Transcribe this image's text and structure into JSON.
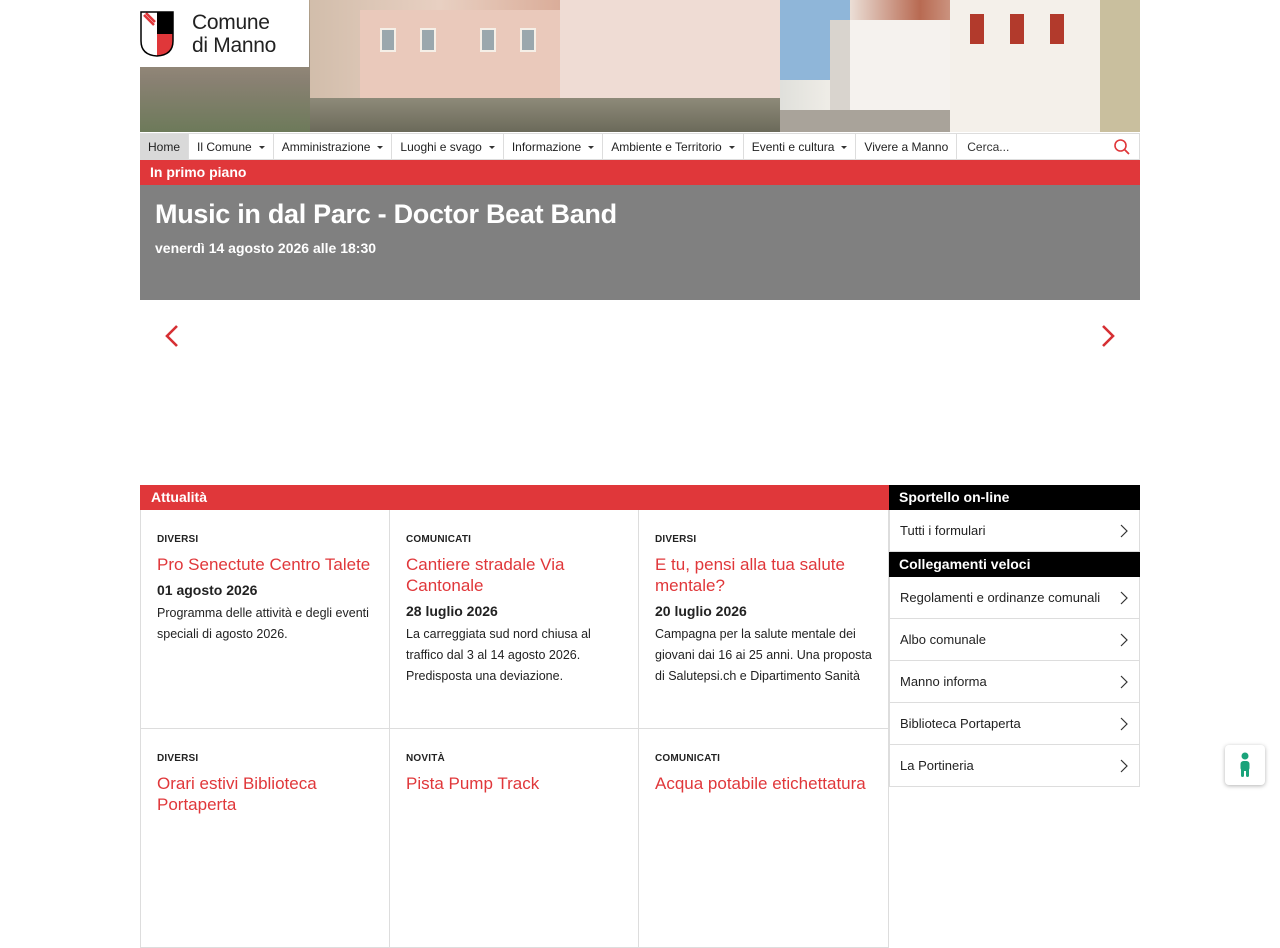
{
  "logo": {
    "line1": "Comune",
    "line2": "di Manno"
  },
  "nav": {
    "items": [
      {
        "label": "Home",
        "dropdown": false
      },
      {
        "label": "Il Comune",
        "dropdown": true
      },
      {
        "label": "Amministrazione",
        "dropdown": true
      },
      {
        "label": "Luoghi e svago",
        "dropdown": true
      },
      {
        "label": "Informazione",
        "dropdown": true
      },
      {
        "label": "Ambiente e Territorio",
        "dropdown": true
      },
      {
        "label": "Eventi e cultura",
        "dropdown": true
      },
      {
        "label": "Vivere a Manno",
        "dropdown": false
      }
    ],
    "search_placeholder": "Cerca..."
  },
  "highlight": {
    "label": "In primo piano",
    "title": "Music in dal Parc - Doctor Beat Band",
    "date": "venerdì 14 agosto 2026 alle 18:30"
  },
  "news": {
    "label": "Attualità",
    "cards": [
      {
        "category": "DIVERSI",
        "title": "Pro Senectute Centro Talete",
        "date": "01 agosto 2026",
        "desc": "Programma delle attività e degli eventi speciali di agosto 2026."
      },
      {
        "category": "COMUNICATI",
        "title": "Cantiere stradale Via Cantonale",
        "date": "28 luglio 2026",
        "desc": "La carreggiata sud nord chiusa al traffico dal 3 al 14 agosto 2026. Predisposta una deviazione."
      },
      {
        "category": "DIVERSI",
        "title": "E tu, pensi alla tua salute mentale?",
        "date": "20 luglio 2026",
        "desc": "Campagna per la salute mentale dei giovani dai 16 ai 25 anni. Una proposta di Salutepsi.ch e Dipartimento Sanità"
      },
      {
        "category": "DIVERSI",
        "title": "Orari estivi Biblioteca Portaperta",
        "date": "",
        "desc": ""
      },
      {
        "category": "NOVITÀ",
        "title": "Pista Pump Track",
        "date": "",
        "desc": ""
      },
      {
        "category": "COMUNICATI",
        "title": "Acqua potabile etichettatura",
        "date": "",
        "desc": ""
      }
    ]
  },
  "sidebar": {
    "sportello": {
      "label": "Sportello on-line",
      "items": [
        "Tutti i formulari"
      ]
    },
    "links": {
      "label": "Collegamenti veloci",
      "items": [
        "Regolamenti e ordinanze comunali",
        "Albo comunale",
        "Manno informa",
        "Biblioteca Portaperta",
        "La Portineria"
      ]
    }
  },
  "colors": {
    "accent": "#e0373a",
    "feature_bg": "#808080",
    "sidebar_head": "#000000"
  }
}
